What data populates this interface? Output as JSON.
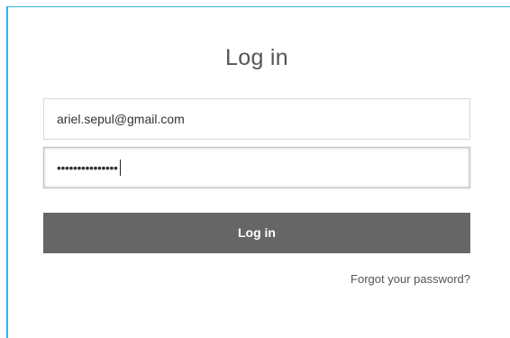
{
  "form": {
    "title": "Log in",
    "email_value": "ariel.sepul@gmail.com",
    "password_mask": "•••••••••••••••",
    "submit_label": "Log in",
    "forgot_link": "Forgot your password?"
  },
  "colors": {
    "frame_accent": "#35b2e4",
    "button_bg": "#666666",
    "button_text": "#ffffff"
  }
}
